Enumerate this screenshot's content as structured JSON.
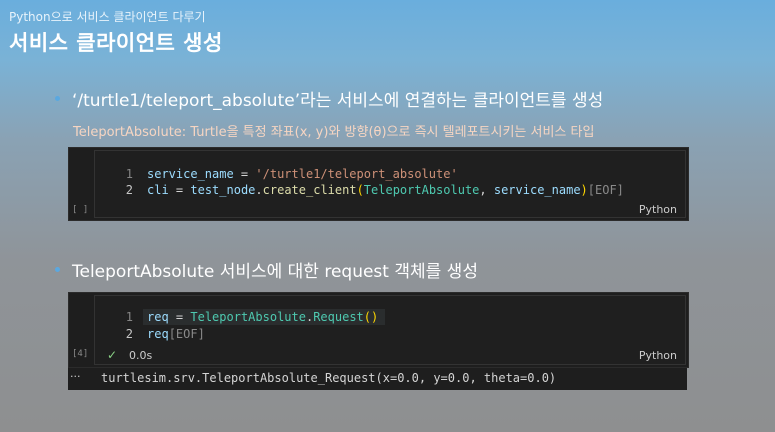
{
  "header": {
    "subtitle": "Python으로 서비스 클라이언트 다루기",
    "title": "서비스 클라이언트 생성"
  },
  "bullets": [
    {
      "text": "‘/turtle1/teleport_absolute’라는 서비스에 연결하는 클라이언트를 생성"
    },
    {
      "text": "TeleportAbsolute 서비스에 대한 request 객체를 생성"
    }
  ],
  "description": "TeleportAbsolute: Turtle을 특정 좌표(x, y)와 방향(θ)으로 즉시 텔레포트시키는 서비스 타입",
  "cell1": {
    "exec_label": "[ ]",
    "language": "Python",
    "line_numbers": [
      "1",
      "2"
    ],
    "line1": {
      "var": "service_name",
      "op": " = ",
      "str": "'/turtle1/teleport_absolute'"
    },
    "line2": {
      "var": "cli",
      "op": " = ",
      "obj": "test_node",
      "dot": ".",
      "fn": "create_client",
      "lp": "(",
      "cls": "TeleportAbsolute",
      "comma": ", ",
      "arg": "service_name",
      "rp": ")",
      "eof": "[EOF]"
    }
  },
  "cell2": {
    "exec_label": "[4]",
    "language": "Python",
    "line_numbers": [
      "1",
      "2"
    ],
    "line1": {
      "var": "req",
      "op": " = ",
      "cls": "TeleportAbsolute",
      "dot": ".",
      "cls2": "Request",
      "parens": "()"
    },
    "line2": {
      "var": "req",
      "eof": "[EOF]"
    },
    "status_icon": "check-icon",
    "status_time": "0.0s"
  },
  "output": {
    "ellipsis": "···",
    "text": "turtlesim.srv.TeleportAbsolute_Request(x=0.0, y=0.0, theta=0.0)"
  }
}
